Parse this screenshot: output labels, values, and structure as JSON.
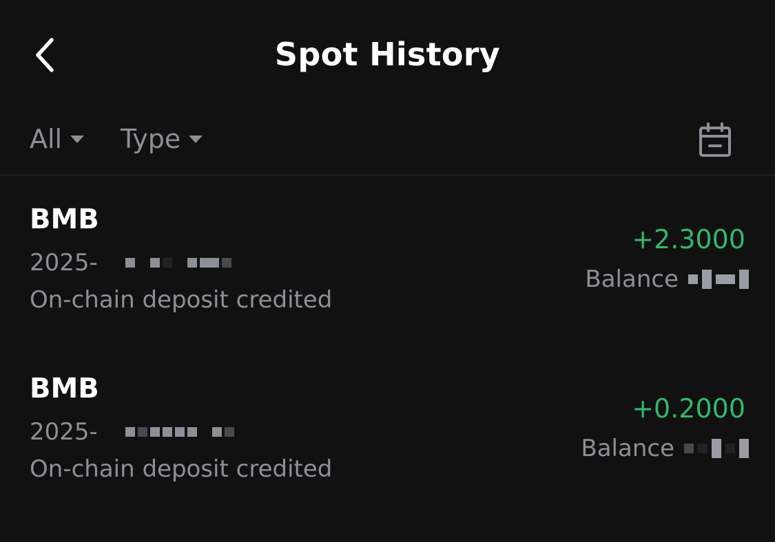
{
  "header": {
    "title": "Spot History",
    "back_icon": "chevron-left-icon"
  },
  "filters": {
    "all_label": "All",
    "type_label": "Type",
    "calendar_icon": "calendar-icon"
  },
  "records": [
    {
      "asset": "BMB",
      "date": "2025-",
      "description": "On-chain deposit credited",
      "amount": "+2.3000",
      "balance_label": "Balance"
    },
    {
      "asset": "BMB",
      "date": "2025-",
      "description": "On-chain deposit credited",
      "amount": "+0.2000",
      "balance_label": "Balance"
    }
  ],
  "colors": {
    "background": "#111111",
    "primary_text": "#ffffff",
    "secondary_text": "#8d9096",
    "positive": "#33b86b",
    "divider": "#2a2a2a"
  }
}
